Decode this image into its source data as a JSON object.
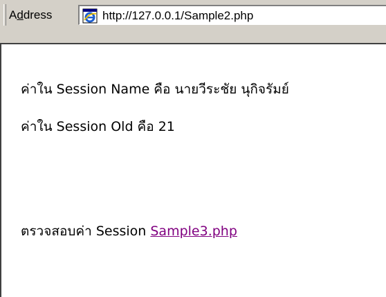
{
  "toolbar": {
    "address_label_prefix": "A",
    "address_label_underlined": "d",
    "address_label_suffix": "dress",
    "url": "http://127.0.0.1/Sample2.php",
    "icon": "ie-page-icon"
  },
  "page": {
    "line1": "ค่าใน Session Name คือ นายวีระชัย นุกิจรัมย์",
    "line2": "ค่าใน Session Old คือ 21",
    "line3_prefix": "ตรวจสอบค่า Session ",
    "link_text": "Sample3.php"
  },
  "colors": {
    "toolbar_bg": "#d4d0c8",
    "link_visited": "#800080"
  }
}
